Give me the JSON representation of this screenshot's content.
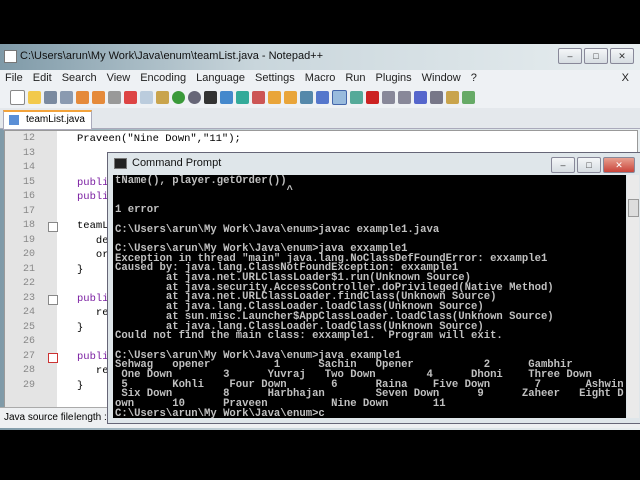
{
  "notepad": {
    "title": "C:\\Users\\arun\\My Work\\Java\\enum\\teamList.java - Notepad++",
    "menu": [
      "File",
      "Edit",
      "Search",
      "View",
      "Encoding",
      "Language",
      "Settings",
      "Macro",
      "Run",
      "Plugins",
      "Window",
      "?"
    ],
    "close_doc": "X",
    "tab": "teamList.java",
    "lines": [
      {
        "n": "12",
        "code": "Praveen(\"Nine Down\",\"11\");"
      },
      {
        "n": "13",
        "code": ""
      },
      {
        "n": "14",
        "code": ""
      },
      {
        "n": "15",
        "code": "publi"
      },
      {
        "n": "16",
        "code": "publi"
      },
      {
        "n": "17",
        "code": ""
      },
      {
        "n": "18",
        "code": "teamL"
      },
      {
        "n": "19",
        "code": "   de"
      },
      {
        "n": "20",
        "code": "   or"
      },
      {
        "n": "21",
        "code": "}"
      },
      {
        "n": "22",
        "code": ""
      },
      {
        "n": "23",
        "code": "publi"
      },
      {
        "n": "24",
        "code": "   re"
      },
      {
        "n": "25",
        "code": "}"
      },
      {
        "n": "26",
        "code": ""
      },
      {
        "n": "27",
        "code": "publi"
      },
      {
        "n": "28",
        "code": "   re"
      },
      {
        "n": "29",
        "code": "}"
      }
    ],
    "status": {
      "type": "Java source file",
      "length": "length :"
    }
  },
  "cmd": {
    "title": "Command Prompt",
    "output": "tName(), player.getOrder())\n                           ^\n\n1 error\n\nC:\\Users\\arun\\My Work\\Java\\enum>javac example1.java\n\nC:\\Users\\arun\\My Work\\Java\\enum>java exxample1\nException in thread \"main\" java.lang.NoClassDefFoundError: exxample1\nCaused by: java.lang.ClassNotFoundException: exxample1\n        at java.net.URLClassLoader$1.run(Unknown Source)\n        at java.security.AccessController.doPrivileged(Native Method)\n        at java.net.URLClassLoader.findClass(Unknown Source)\n        at java.lang.ClassLoader.loadClass(Unknown Source)\n        at sun.misc.Launcher$AppClassLoader.loadClass(Unknown Source)\n        at java.lang.ClassLoader.loadClass(Unknown Source)\nCould not find the main class: exxample1.  Program will exit.\n\nC:\\Users\\arun\\My Work\\Java\\enum>java example1\nSehwag   opener          1      Sachin   Opener           2      Gambhir\n One Down        3      Yuvraj   Two Down        4      Dhoni    Three Down\n 5       Kohli    Four Down       6      Raina    Five Down       7       Ashwin\n Six Down        8      Harbhajan        Seven Down      9      Zaheer   Eight D\nown      10      Praveen          Nine Down       11\nC:\\Users\\arun\\My Work\\Java\\enum>c"
  },
  "window_buttons": {
    "min": "–",
    "max": "□",
    "close": "✕"
  }
}
